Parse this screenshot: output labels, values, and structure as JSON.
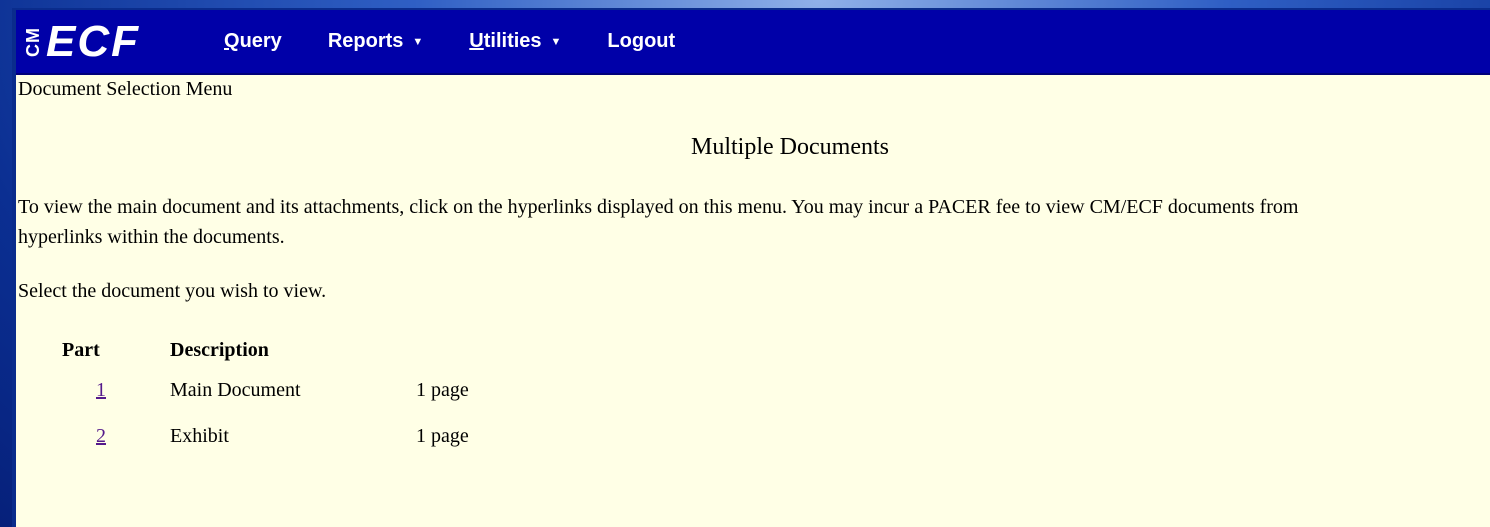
{
  "logo": {
    "cm": "CM",
    "ecf": "ECF"
  },
  "menu": [
    {
      "label": "Query",
      "underline": "Q",
      "rest": "uery",
      "dropdown": false
    },
    {
      "label": "Reports",
      "underline": "",
      "rest": "Reports",
      "dropdown": true
    },
    {
      "label": "Utilities",
      "underline": "U",
      "rest": "tilities",
      "dropdown": true
    },
    {
      "label": "Logout",
      "underline": "",
      "rest": "Logout",
      "dropdown": false
    }
  ],
  "breadcrumb": "Document Selection Menu",
  "title": "Multiple Documents",
  "instructions": {
    "line1": "To view the main document and its attachments, click on the hyperlinks displayed on this menu. You may incur a PACER fee to view CM/ECF documents from",
    "line2": "hyperlinks within the documents."
  },
  "select_prompt": "Select the document you wish to view.",
  "table": {
    "headers": {
      "part": "Part",
      "description": "Description"
    },
    "rows": [
      {
        "part": "1",
        "description": "Main Document",
        "pages": "1 page"
      },
      {
        "part": "2",
        "description": "Exhibit",
        "pages": "1 page"
      }
    ]
  },
  "colors": {
    "navbar": "#0000a8",
    "page_bg": "#ffffe6",
    "link": "#551a8b"
  }
}
